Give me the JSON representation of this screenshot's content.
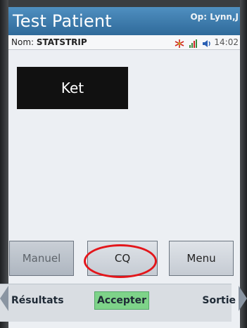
{
  "header": {
    "title": "Test Patient",
    "operator": "Op: Lynn,J"
  },
  "info_bar": {
    "nom_label": "Nom:",
    "nom_value": "STATSTRIP",
    "icons": [
      "wireless-icon",
      "signal-bars-icon",
      "speaker-icon"
    ],
    "time": "14:02"
  },
  "main": {
    "test_tile": "Ket"
  },
  "buttons": {
    "manuel": "Manuel",
    "cq": "CQ",
    "menu": "Menu"
  },
  "footer": {
    "left": "Résultats",
    "center": "Accepter",
    "right": "Sortie"
  },
  "colors": {
    "header_bg": "#3a7db0",
    "highlight_ring": "#e3161b",
    "accept_bg": "#7ed389"
  }
}
